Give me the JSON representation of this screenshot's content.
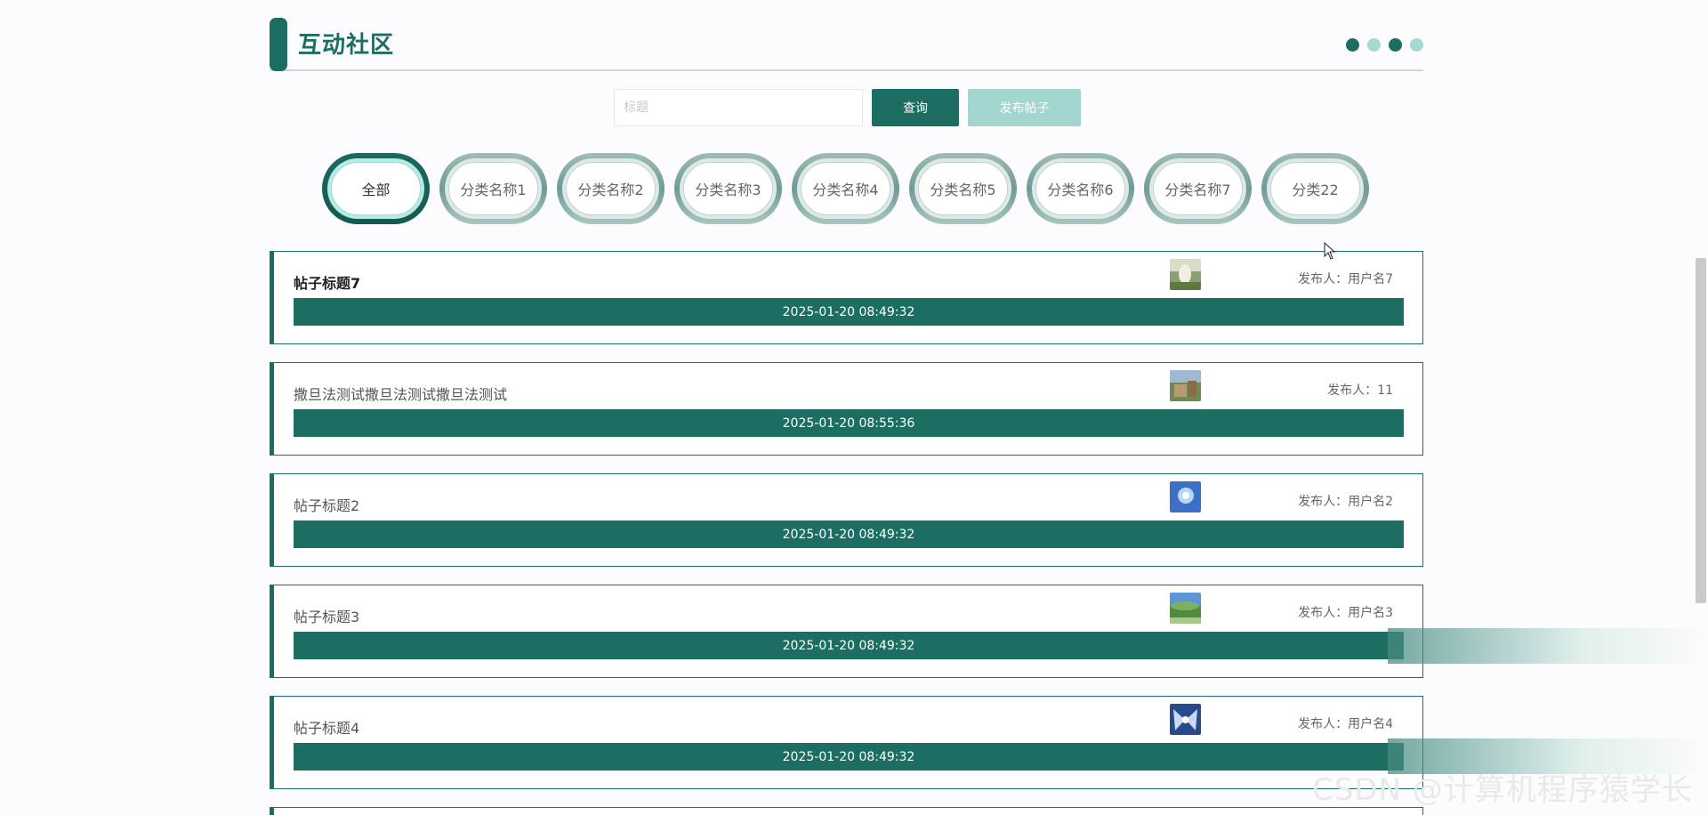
{
  "header": {
    "title": "互动社区"
  },
  "search": {
    "placeholder": "标题",
    "value": ""
  },
  "buttons": {
    "query": "查询",
    "publish": "发布帖子"
  },
  "categories": [
    {
      "label": "全部",
      "active": true
    },
    {
      "label": "分类名称1"
    },
    {
      "label": "分类名称2"
    },
    {
      "label": "分类名称3"
    },
    {
      "label": "分类名称4"
    },
    {
      "label": "分类名称5"
    },
    {
      "label": "分类名称6"
    },
    {
      "label": "分类名称7"
    },
    {
      "label": "分类22"
    }
  ],
  "posts": [
    {
      "title": "帖子标题7",
      "author": "发布人：用户名7",
      "date": "2025-01-20 08:49:32"
    },
    {
      "title": "撒旦法测试撒旦法测试撒旦法测试",
      "author": "发布人：11",
      "date": "2025-01-20 08:55:36"
    },
    {
      "title": "帖子标题2",
      "author": "发布人：用户名2",
      "date": "2025-01-20 08:49:32"
    },
    {
      "title": "帖子标题3",
      "author": "发布人：用户名3",
      "date": "2025-01-20 08:49:32"
    },
    {
      "title": "帖子标题4",
      "author": "发布人：用户名4",
      "date": "2025-01-20 08:49:32"
    }
  ],
  "watermark": "CSDN @计算机程序猿学长",
  "colors": {
    "primary": "#1d6e62",
    "primary_light": "#a2d6cf"
  }
}
